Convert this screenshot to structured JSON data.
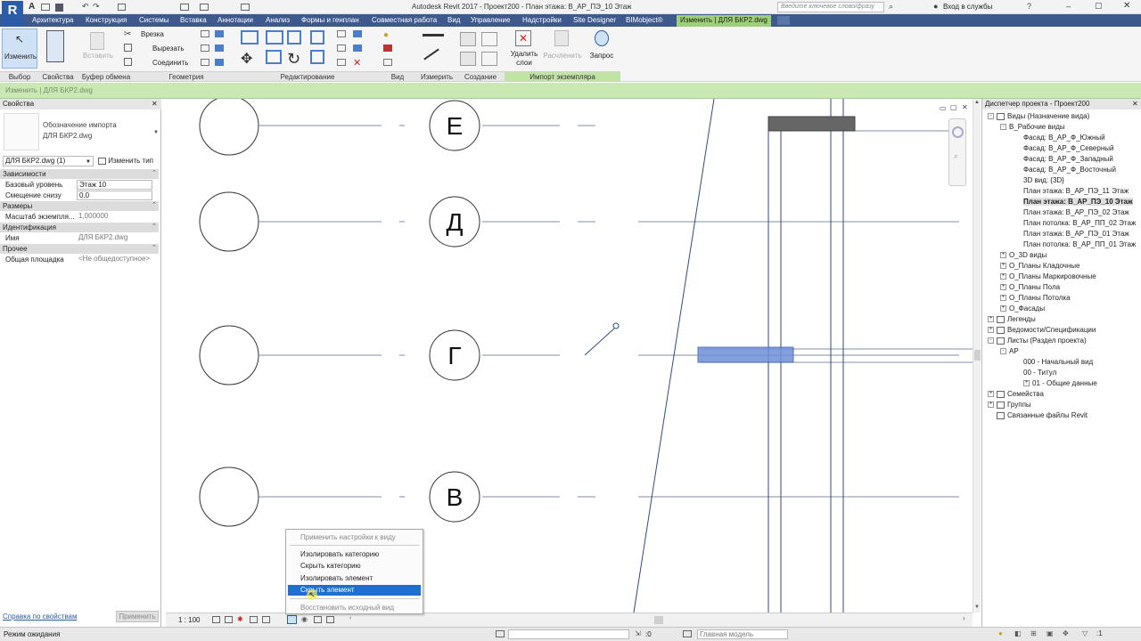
{
  "app": {
    "title": "Autodesk Revit 2017 -    Проект200 - План этажа: В_АР_ПЭ_10 Этаж",
    "search_placeholder": "Введите ключевое слово/фразу",
    "signin": "Вход в службы",
    "app_button": "R"
  },
  "tabs": [
    "Архитектура",
    "Конструкция",
    "Системы",
    "Вставка",
    "Аннотации",
    "Анализ",
    "Формы и генплан",
    "Совместная работа",
    "Вид",
    "Управление",
    "Надстройки",
    "Site Designer",
    "BIMobject®",
    "Изменить | ДЛЯ БКР2.dwg"
  ],
  "ribbon": {
    "modify_label": "Изменить",
    "paste_label": "Вставить",
    "cut_label": "Врезка",
    "cut2_label": "Вырезать",
    "join_label": "Соединить",
    "delete_layers_label": "Удалить\nслои",
    "explode_label": "Расчленить",
    "query_label": "Запрос",
    "panels": [
      "Выбор",
      "Свойства",
      "Буфер обмена",
      "Геометрия",
      "Редактирование",
      "Вид",
      "Измерить",
      "Создание",
      "Импорт экземпляра"
    ]
  },
  "context_bar": "Изменить | ДЛЯ БКР2.dwg",
  "properties": {
    "header": "Свойства",
    "type_name_line1": "Обозначение импорта",
    "type_name_line2": "ДЛЯ БКР2.dwg",
    "selector": "ДЛЯ БКР2.dwg (1)",
    "edit_type": "Изменить тип",
    "sections": [
      {
        "name": "Зависимости",
        "rows": [
          {
            "k": "Базовый уровень",
            "v": "Этаж 10"
          },
          {
            "k": "Смещение снизу",
            "v": "0,0"
          }
        ]
      },
      {
        "name": "Размеры",
        "rows": [
          {
            "k": "Масштаб экземпля...",
            "v": "1,000000"
          }
        ]
      },
      {
        "name": "Идентификация",
        "rows": [
          {
            "k": "Имя",
            "v": "ДЛЯ БКР2.dwg"
          }
        ]
      },
      {
        "name": "Прочее",
        "rows": [
          {
            "k": "Общая площадка",
            "v": "<Не общедоступное>"
          }
        ]
      }
    ],
    "help_link": "Справка по свойствам",
    "apply": "Применить"
  },
  "grid_labels": [
    "Е",
    "Д",
    "Г",
    "В"
  ],
  "view_scale": "1 : 100",
  "context_menu": {
    "items": [
      {
        "label": "Применить настройки к виду",
        "state": "disabled"
      },
      {
        "label": "Изолировать категорию",
        "state": "normal"
      },
      {
        "label": "Скрыть категорию",
        "state": "normal"
      },
      {
        "label": "Изолировать элемент",
        "state": "normal"
      },
      {
        "label": "Скрыть элемент",
        "state": "selected"
      },
      {
        "label": "Восстановить исходный вид",
        "state": "disabled"
      }
    ]
  },
  "browser": {
    "header": "Диспетчер проекта - Проект200",
    "items": [
      {
        "label": "Виды (Назначение вида)",
        "level": 0,
        "toggle": "-"
      },
      {
        "label": "В_Рабочие виды",
        "level": 1,
        "toggle": "-"
      },
      {
        "label": "Фасад: В_АР_Ф_Южный",
        "level": 2
      },
      {
        "label": "Фасад: В_АР_Ф_Северный",
        "level": 2
      },
      {
        "label": "Фасад: В_АР_Ф_Западный",
        "level": 2
      },
      {
        "label": "Фасад: В_АР_Ф_Восточный",
        "level": 2
      },
      {
        "label": "3D вид: {3D}",
        "level": 2
      },
      {
        "label": "План этажа: В_АР_ПЭ_11 Этаж",
        "level": 2
      },
      {
        "label": "План этажа: В_АР_ПЭ_10 Этаж",
        "level": 2,
        "bold": true
      },
      {
        "label": "План этажа: В_АР_ПЭ_02 Этаж",
        "level": 2
      },
      {
        "label": "План потолка: В_АР_ПП_02 Этаж",
        "level": 2
      },
      {
        "label": "План этажа: В_АР_ПЭ_01 Этаж",
        "level": 2
      },
      {
        "label": "План потолка: В_АР_ПП_01 Этаж",
        "level": 2
      },
      {
        "label": "О_3D виды",
        "level": 1,
        "toggle": "+"
      },
      {
        "label": "О_Планы Кладочные",
        "level": 1,
        "toggle": "+"
      },
      {
        "label": "О_Планы Маркировочные",
        "level": 1,
        "toggle": "+"
      },
      {
        "label": "О_Планы Пола",
        "level": 1,
        "toggle": "+"
      },
      {
        "label": "О_Планы Потолка",
        "level": 1,
        "toggle": "+"
      },
      {
        "label": "О_Фасады",
        "level": 1,
        "toggle": "+"
      },
      {
        "label": "Легенды",
        "level": 0,
        "toggle": "+"
      },
      {
        "label": "Ведомости/Спецификации",
        "level": 0,
        "toggle": "+"
      },
      {
        "label": "Листы (Раздел проекта)",
        "level": 0,
        "toggle": "-"
      },
      {
        "label": "АР",
        "level": 1,
        "toggle": "-"
      },
      {
        "label": "000 - Начальный вид",
        "level": 2
      },
      {
        "label": "00 - Титул",
        "level": 2
      },
      {
        "label": "01 - Общие данные",
        "level": 2,
        "toggle": "+"
      },
      {
        "label": "Семейства",
        "level": 0,
        "toggle": "+"
      },
      {
        "label": "Группы",
        "level": 0,
        "toggle": "+"
      },
      {
        "label": "Связанные файлы Revit",
        "level": 0
      }
    ]
  },
  "status": {
    "text": "Режим ожидания",
    "coord": ":0",
    "model": "Главная модель"
  },
  "colors": {
    "tabbar": "#3e5a8c",
    "context_green": "#9ed07a",
    "selection_blue": "#1e6fd0",
    "grid_line": "#8aa0c8"
  }
}
